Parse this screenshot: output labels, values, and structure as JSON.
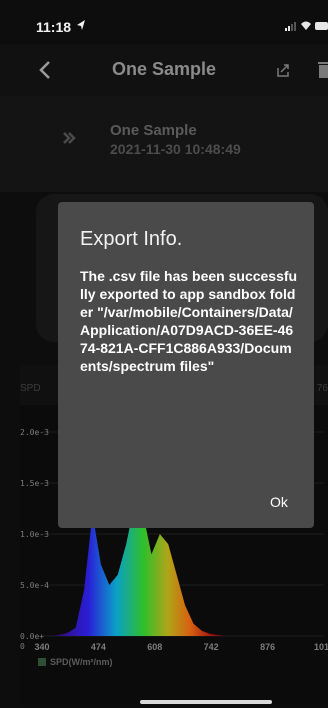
{
  "status_bar": {
    "time": "11:18"
  },
  "nav": {
    "title": "One Sample"
  },
  "sample": {
    "name": "One Sample",
    "timestamp": "2021-11-30 10:48:49"
  },
  "tabs": {
    "left_partial": "SPD",
    "right_partial": "76"
  },
  "dialog": {
    "title": "Export Info.",
    "message": "The .csv file has been successfully exported to app sandbox folder \"/var/mobile/Containers/Data/Application/A07D9ACD-36EE-4674-821A-CFF1C886A933/Documents/spectrum files\"",
    "ok_label": "Ok"
  },
  "chart_data": {
    "type": "area",
    "x": [
      340,
      360,
      380,
      400,
      420,
      440,
      460,
      480,
      500,
      520,
      540,
      560,
      580,
      600,
      620,
      640,
      660,
      680,
      700,
      720,
      740,
      760,
      780
    ],
    "series": [
      {
        "name": "SPD(W/m²/nm)",
        "values": [
          0.0,
          0.0,
          1e-05,
          3e-05,
          8e-05,
          0.00045,
          0.0012,
          0.0007,
          0.0005,
          0.0006,
          0.0009,
          0.0013,
          0.0012,
          0.0008,
          0.001,
          0.0009,
          0.0006,
          0.0003,
          0.00012,
          5e-05,
          2e-05,
          1e-05,
          0.0
        ]
      }
    ],
    "ytick_labels": [
      "2.0e-3",
      "1.5e-3",
      "1.0e-3",
      "5.0e-4",
      "0.0e+\n0"
    ],
    "ytick_values": [
      0.002,
      0.0015,
      0.001,
      0.0005,
      0.0
    ],
    "xticks": [
      340,
      474,
      608,
      742,
      876,
      1010
    ],
    "xlim": [
      340,
      1010
    ],
    "ylim": [
      0,
      0.002
    ],
    "xlabel": "",
    "ylabel": "",
    "legend": [
      "SPD(W/m²/nm)"
    ],
    "legend_color": "#2f4f35"
  },
  "colors": {
    "dialog_bg": "#4a4a4a",
    "screen_bg": "#050505",
    "text_primary": "#ffffff"
  }
}
